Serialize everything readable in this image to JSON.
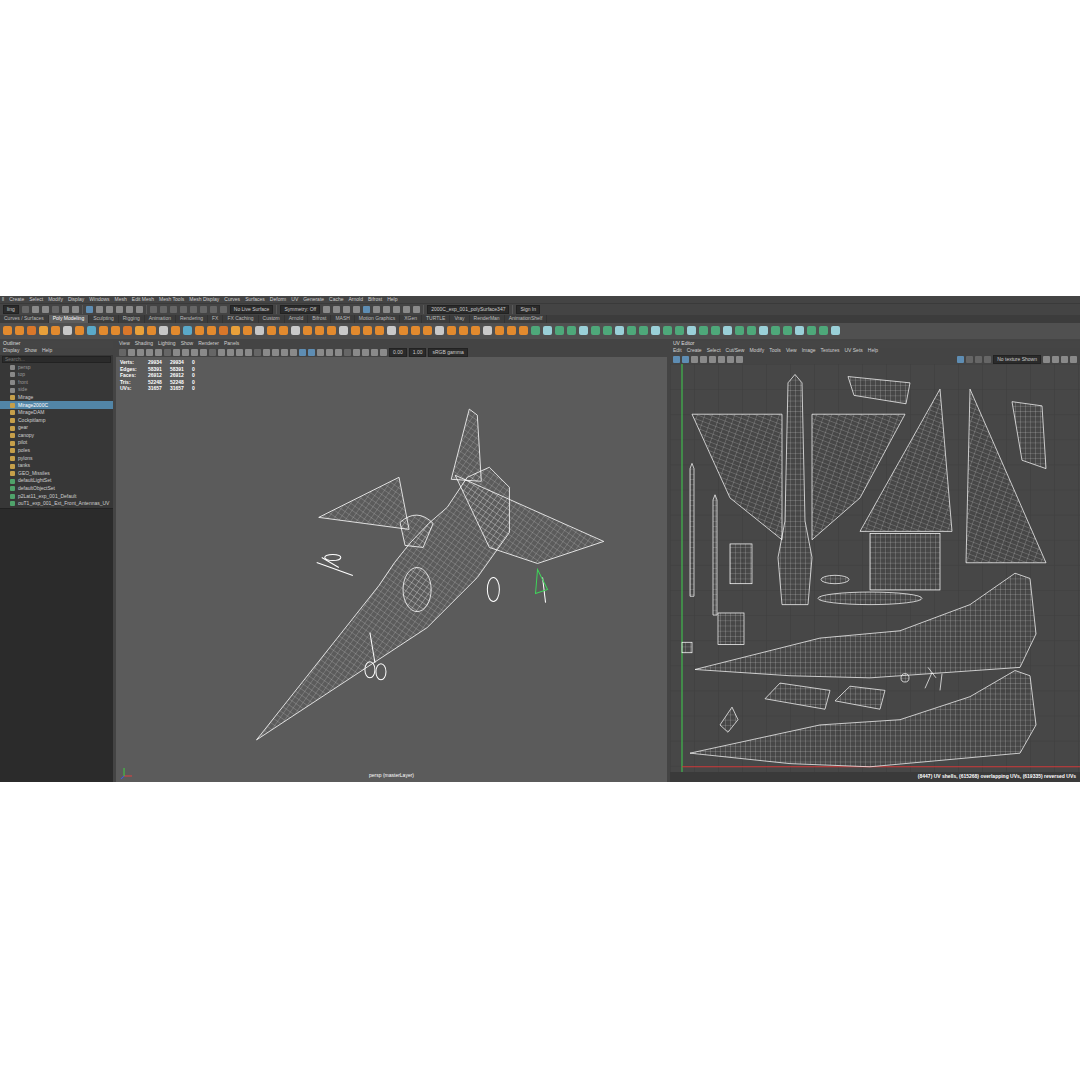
{
  "menubar": {
    "items": [
      "ll",
      "Create",
      "Select",
      "Modify",
      "Display",
      "Windows",
      "Mesh",
      "Edit Mesh",
      "Mesh Tools",
      "Mesh Display",
      "Curves",
      "Surfaces",
      "Deform",
      "UV",
      "Generate",
      "Cache",
      "Arnold",
      "Bifrost",
      "Help"
    ]
  },
  "status_line": {
    "mode": "ling",
    "live_surface": "No Live Surface",
    "symmetry": "Symmetry: Off",
    "name_field": "2000C_exp_001_polySurface347",
    "sign_in": "Sign In"
  },
  "shelf": {
    "tabs": [
      {
        "label": "Curves / Surfaces",
        "selected": false
      },
      {
        "label": "Poly Modeling",
        "selected": true
      },
      {
        "label": "Sculpting",
        "selected": false
      },
      {
        "label": "Rigging",
        "selected": false
      },
      {
        "label": "Animation",
        "selected": false
      },
      {
        "label": "Rendering",
        "selected": false
      },
      {
        "label": "FX",
        "selected": false
      },
      {
        "label": "FX Caching",
        "selected": false
      },
      {
        "label": "Custom",
        "selected": false
      },
      {
        "label": "Arnold",
        "selected": false
      },
      {
        "label": "Bifrost",
        "selected": false
      },
      {
        "label": "MASH",
        "selected": false
      },
      {
        "label": "Motion Graphics",
        "selected": false
      },
      {
        "label": "XGen",
        "selected": false
      },
      {
        "label": "TURTLE",
        "selected": false
      },
      {
        "label": "Vray",
        "selected": false
      },
      {
        "label": "RenderMan",
        "selected": false
      },
      {
        "label": "AnimationShelf",
        "selected": false
      }
    ]
  },
  "outliner": {
    "title": "Outliner",
    "menu": [
      "Display",
      "Show",
      "Help"
    ],
    "search": {
      "placeholder": "Search..."
    },
    "items": [
      {
        "label": "persp",
        "kind": "camera",
        "selected": false
      },
      {
        "label": "top",
        "kind": "camera",
        "selected": false
      },
      {
        "label": "front",
        "kind": "camera",
        "selected": false
      },
      {
        "label": "side",
        "kind": "camera",
        "selected": false
      },
      {
        "label": "Mirage",
        "kind": "group",
        "selected": false
      },
      {
        "label": "Mirage2000C",
        "kind": "group",
        "selected": true
      },
      {
        "label": "MirageDAM",
        "kind": "group",
        "selected": false
      },
      {
        "label": "Cockpitlamp",
        "kind": "group",
        "selected": false
      },
      {
        "label": "gear",
        "kind": "group",
        "selected": false
      },
      {
        "label": "canopy",
        "kind": "group",
        "selected": false
      },
      {
        "label": "pilot",
        "kind": "group",
        "selected": false
      },
      {
        "label": "poles",
        "kind": "group",
        "selected": false
      },
      {
        "label": "pylons",
        "kind": "group",
        "selected": false
      },
      {
        "label": "tanks",
        "kind": "group",
        "selected": false
      },
      {
        "label": "GEO_Missiles",
        "kind": "group",
        "selected": false
      },
      {
        "label": "defaultLightSet",
        "kind": "set",
        "selected": false
      },
      {
        "label": "defaultObjectSet",
        "kind": "set",
        "selected": false
      },
      {
        "label": "p2Lat11_exp_001_Default",
        "kind": "set",
        "selected": false
      },
      {
        "label": "ouT1_exp_001_Ext_Front_Antennas_UV",
        "kind": "set",
        "selected": false
      }
    ]
  },
  "viewport": {
    "menu": [
      "View",
      "Shading",
      "Lighting",
      "Show",
      "Renderer",
      "Panels"
    ],
    "fields": [
      "0.00",
      "1.00"
    ],
    "color_space": "sRGB gamma",
    "hud": [
      {
        "label": "Verts:",
        "values": [
          "29934",
          "29934",
          "0"
        ]
      },
      {
        "label": "Edges:",
        "values": [
          "58391",
          "58391",
          "0"
        ]
      },
      {
        "label": "Faces:",
        "values": [
          "26912",
          "26912",
          "0"
        ]
      },
      {
        "label": "Tris:",
        "values": [
          "52248",
          "52248",
          "0"
        ]
      },
      {
        "label": "UVs:",
        "values": [
          "31657",
          "31657",
          "0"
        ]
      }
    ],
    "camera_label": "persp (masterLayer)"
  },
  "uv_editor": {
    "title": "UV Editor",
    "menu": [
      "Edit",
      "Create",
      "Select",
      "Cut/Sew",
      "Modify",
      "Tools",
      "View",
      "Image",
      "Textures",
      "UV Sets",
      "Help"
    ],
    "toolbar_text": "No texture Shown",
    "status": "(8447) UV shells, (615268) overlapping UVs, (619335) reversed UVs"
  }
}
